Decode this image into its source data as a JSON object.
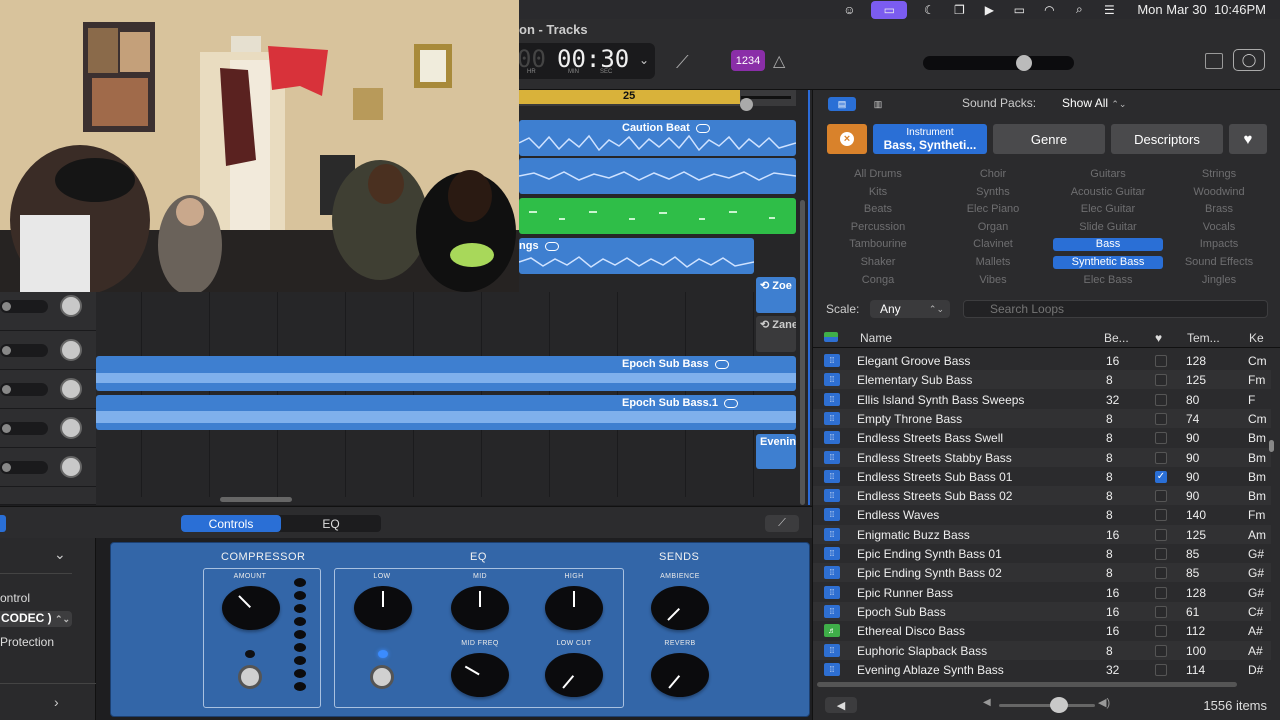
{
  "menubar": {
    "date": "Mon Mar 30",
    "time": "10:46PM",
    "icons": [
      "finder-icon",
      "screen-mirror-icon",
      "focus-moon-icon",
      "window-icon",
      "play-icon",
      "battery-icon",
      "wifi-icon",
      "search-icon",
      "control-center-icon"
    ]
  },
  "toolbar": {
    "window_title": "on - Tracks",
    "lcd_time": "00:30",
    "lcd_dim": "00",
    "lcd_hr": "HR",
    "lcd_min": "MIN",
    "lcd_sec": "SEC",
    "count_in": "1234",
    "master_volume": 0.6
  },
  "ruler": {
    "bar_number": "25"
  },
  "regions": {
    "caution_beat": "Caution Beat",
    "strings": "ngs",
    "zoe": "Zoe",
    "zane": "Zane",
    "epoch_sub_bass": "Epoch Sub Bass",
    "epoch_sub_bass_1": "Epoch Sub Bass.1",
    "evening": "Evenin"
  },
  "smart_controls": {
    "tabs": [
      "Controls",
      "EQ"
    ],
    "active_tab": "Controls",
    "inspector": {
      "line1": "ontrol",
      "popup": "CODEC )",
      "line3": "Protection"
    },
    "sections": {
      "compressor": "COMPRESSOR",
      "eq": "EQ",
      "sends": "SENDS"
    },
    "knobs": {
      "amount": "AMOUNT",
      "low": "LOW",
      "mid": "MID",
      "high": "HIGH",
      "mid_freq": "MID FREQ",
      "low_cut": "LOW CUT",
      "ambience": "AMBIENCE",
      "reverb": "REVERB"
    }
  },
  "browser": {
    "sound_packs_label": "Sound Packs:",
    "sound_packs_value": "Show All",
    "filters": {
      "instrument_label": "Instrument",
      "instrument_value": "Bass, Syntheti...",
      "genre": "Genre",
      "descriptors": "Descriptors"
    },
    "keywords": [
      [
        "All Drums",
        "Choir",
        "Guitars",
        "Strings"
      ],
      [
        "Kits",
        "Synths",
        "Acoustic Guitar",
        "Woodwind"
      ],
      [
        "Beats",
        "Elec Piano",
        "Elec Guitar",
        "Brass"
      ],
      [
        "Percussion",
        "Organ",
        "Slide Guitar",
        "Vocals"
      ],
      [
        "Tambourine",
        "Clavinet",
        "Bass",
        "Impacts"
      ],
      [
        "Shaker",
        "Mallets",
        "Synthetic Bass",
        "Sound Effects"
      ],
      [
        "Conga",
        "Vibes",
        "Elec Bass",
        "Jingles"
      ]
    ],
    "selected_keywords": [
      "Bass",
      "Synthetic Bass"
    ],
    "scale_label": "Scale:",
    "scale_value": "Any",
    "search_placeholder": "Search Loops",
    "columns": {
      "name": "Name",
      "beats": "Be...",
      "tempo": "Tem...",
      "key": "Ke"
    },
    "rows": [
      {
        "name": "Elegant Groove Bass",
        "beats": "16",
        "fav": false,
        "tempo": "128",
        "key": "Cm",
        "type": "audio"
      },
      {
        "name": "Elementary Sub Bass",
        "beats": "8",
        "fav": false,
        "tempo": "125",
        "key": "Fm",
        "type": "audio"
      },
      {
        "name": "Ellis Island Synth Bass Sweeps",
        "beats": "32",
        "fav": false,
        "tempo": "80",
        "key": "F",
        "type": "audio"
      },
      {
        "name": "Empty Throne Bass",
        "beats": "8",
        "fav": false,
        "tempo": "74",
        "key": "Cm",
        "type": "audio"
      },
      {
        "name": "Endless Streets Bass Swell",
        "beats": "8",
        "fav": false,
        "tempo": "90",
        "key": "Bm",
        "type": "audio"
      },
      {
        "name": "Endless Streets Stabby Bass",
        "beats": "8",
        "fav": false,
        "tempo": "90",
        "key": "Bm",
        "type": "audio"
      },
      {
        "name": "Endless Streets Sub Bass 01",
        "beats": "8",
        "fav": true,
        "tempo": "90",
        "key": "Bm",
        "type": "audio"
      },
      {
        "name": "Endless Streets Sub Bass 02",
        "beats": "8",
        "fav": false,
        "tempo": "90",
        "key": "Bm",
        "type": "audio"
      },
      {
        "name": "Endless Waves",
        "beats": "8",
        "fav": false,
        "tempo": "140",
        "key": "Fm",
        "type": "audio"
      },
      {
        "name": "Enigmatic Buzz Bass",
        "beats": "16",
        "fav": false,
        "tempo": "125",
        "key": "Am",
        "type": "audio"
      },
      {
        "name": "Epic Ending Synth Bass 01",
        "beats": "8",
        "fav": false,
        "tempo": "85",
        "key": "G#",
        "type": "audio"
      },
      {
        "name": "Epic Ending Synth Bass 02",
        "beats": "8",
        "fav": false,
        "tempo": "85",
        "key": "G#",
        "type": "audio"
      },
      {
        "name": "Epic Runner Bass",
        "beats": "16",
        "fav": false,
        "tempo": "128",
        "key": "G#",
        "type": "audio"
      },
      {
        "name": "Epoch Sub Bass",
        "beats": "16",
        "fav": false,
        "tempo": "61",
        "key": "C#",
        "type": "audio"
      },
      {
        "name": "Ethereal Disco Bass",
        "beats": "16",
        "fav": false,
        "tempo": "112",
        "key": "A#",
        "type": "midi"
      },
      {
        "name": "Euphoric Slapback Bass",
        "beats": "8",
        "fav": false,
        "tempo": "100",
        "key": "A#",
        "type": "audio"
      },
      {
        "name": "Evening Ablaze Synth Bass",
        "beats": "32",
        "fav": false,
        "tempo": "114",
        "key": "D#",
        "type": "audio"
      }
    ],
    "item_count": "1556 items"
  },
  "colors": {
    "accent_blue": "#2a6fd6",
    "region_blue": "#3e7fd0",
    "region_green": "#2fbe48",
    "cycle_yellow": "#d9b23a",
    "reset_orange": "#d9822b",
    "smart_controls_panel": "#3366a8"
  }
}
